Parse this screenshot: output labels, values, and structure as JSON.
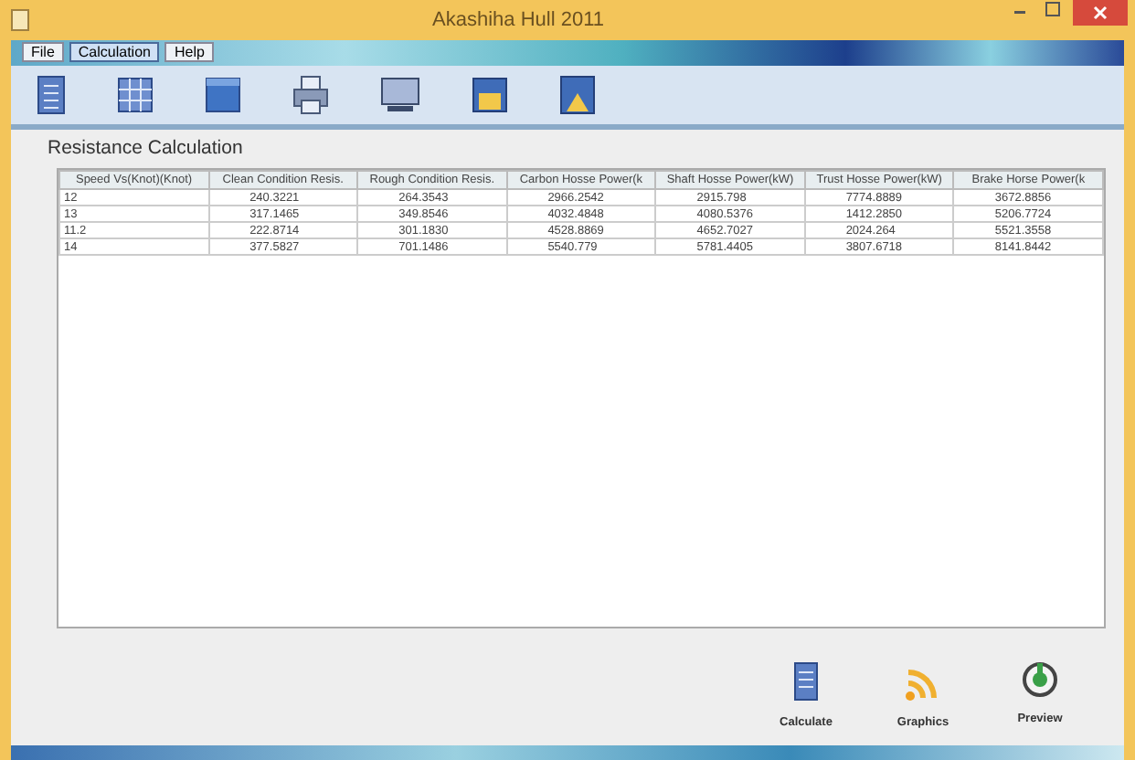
{
  "window": {
    "title": "Akashiha Hull 2011"
  },
  "menu": [
    {
      "label": "File",
      "selected": false
    },
    {
      "label": "Calculation",
      "selected": true
    },
    {
      "label": "Help",
      "selected": false
    }
  ],
  "toolbar": [
    {
      "kind": "document"
    },
    {
      "kind": "grid"
    },
    {
      "kind": "panel"
    },
    {
      "kind": "printer"
    },
    {
      "kind": "monitor"
    },
    {
      "kind": "save"
    },
    {
      "kind": "chart"
    }
  ],
  "panel_title": "Resistance Calculation",
  "table": {
    "columns": [
      "Speed Vs(Knot)(Knot)",
      "Clean Condition Resis.",
      "Rough Condition Resis.",
      "Carbon Hosse Power(k",
      "Shaft Hosse Power(kW)",
      "Trust Hosse Power(kW)",
      "Brake Horse Power(k"
    ],
    "rows": [
      [
        "12",
        "240.3221",
        "264.3543",
        "2966.2542",
        "2915.798",
        "7774.8889",
        "3672.8856"
      ],
      [
        "13",
        "317.1465",
        "349.8546",
        "4032.4848",
        "4080.5376",
        "1412.2850",
        "5206.7724"
      ],
      [
        "11.2",
        "222.8714",
        "301.1830",
        "4528.8869",
        "4652.7027",
        "2024.264",
        "5521.3558"
      ],
      [
        "14",
        "377.5827",
        "701.1486",
        "5540.779",
        "5781.4405",
        "3807.6718",
        "8141.8442"
      ]
    ]
  },
  "actions": [
    {
      "kind": "calculate",
      "label": "Calculate"
    },
    {
      "kind": "graphics",
      "label": "Graphics"
    },
    {
      "kind": "preview",
      "label": "Preview"
    }
  ]
}
